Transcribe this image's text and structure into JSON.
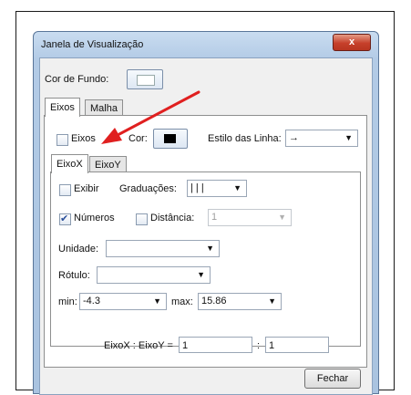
{
  "window": {
    "title": "Janela de Visualização",
    "close_label": "x"
  },
  "background": {
    "label": "Cor de Fundo:"
  },
  "tabs": [
    "Eixos",
    "Malha"
  ],
  "eixos_tab": {
    "axes_checkbox_label": "Eixos",
    "axes_checked": false,
    "color_label": "Cor:",
    "line_style_label": "Estilo das Linha:",
    "line_style_value": "→"
  },
  "axis_tabs": [
    "EixoX",
    "EixoY"
  ],
  "axis_panel": {
    "show_label": "Exibir",
    "show_checked": false,
    "graduations_label": "Graduações:",
    "graduations_value": "| | |",
    "numbers_label": "Números",
    "numbers_checked": true,
    "distance_label": "Distância:",
    "distance_value": "1",
    "unit_label": "Unidade:",
    "unit_value": "",
    "label_label": "Rótulo:",
    "label_value": "",
    "min_label": "min:",
    "min_value": "-4.3",
    "max_label": "max:",
    "max_value": "15.86"
  },
  "ratio": {
    "label": "EixoX : EixoY =",
    "x_value": "1",
    "separator": ":",
    "y_value": "1"
  },
  "footer": {
    "close_button": "Fechar"
  },
  "annotation": {
    "arrow_color": "#e02020"
  },
  "colors": {
    "axis_color": "#000000",
    "background_color": "#ffffff"
  }
}
